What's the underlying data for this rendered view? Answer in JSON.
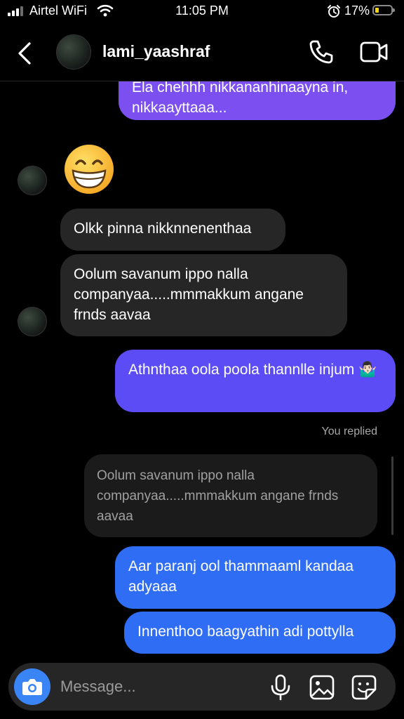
{
  "status_bar": {
    "carrier": "Airtel WiFi",
    "time": "11:05 PM",
    "battery_percent": "17%",
    "battery_level": 0.17,
    "icons": [
      "signal-icon",
      "wifi-icon",
      "alarm-icon",
      "battery-icon"
    ]
  },
  "header": {
    "username": "lami_yaashraf",
    "icons": [
      "back-icon",
      "avatar",
      "phone-icon",
      "video-camera-icon"
    ]
  },
  "messages": [
    {
      "direction": "out",
      "text": "Ela chehhh nikkananhinaayna in, nikkaayttaaa..."
    },
    {
      "direction": "in",
      "text": "😁",
      "type": "emoji"
    },
    {
      "direction": "in",
      "text": "Olkk pinna nikknnenenthaa"
    },
    {
      "direction": "in",
      "text": "Oolum savanum ippo nalla companyaa.....mmmakkum angane frnds aavaa"
    },
    {
      "direction": "out",
      "text": "Athnthaa oola poola thannlle injum 🤷🏻‍♂️"
    },
    {
      "direction": "out",
      "reply_label": "You replied",
      "quoted": "Oolum savanum ippo nalla companyaa.....mmmakkum angane frnds aavaa",
      "text": "Aar paranj ool thammaaml kandaa adyaaa"
    },
    {
      "direction": "out",
      "text": "Innenthoo baagyathin adi pottylla"
    }
  ],
  "composer": {
    "placeholder": "Message...",
    "icons": [
      "camera-icon",
      "microphone-icon",
      "gallery-icon",
      "sticker-icon"
    ]
  },
  "colors": {
    "background": "#000000",
    "incoming_bubble": "#262626",
    "outgoing_purple": "#7b4ff0",
    "outgoing_indigo": "#5b4cf5",
    "outgoing_blue": "#2f6df5",
    "camera_button": "#3a85f6"
  }
}
